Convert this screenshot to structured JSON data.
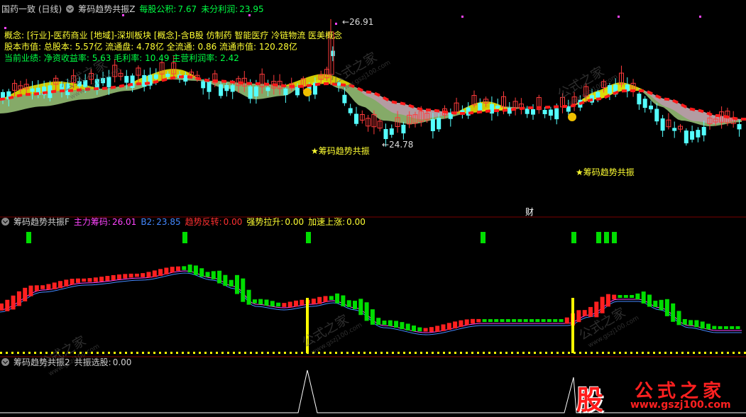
{
  "header": {
    "title": "国药一致 (日线)",
    "indicator": "筹码趋势共振Z",
    "eps_label": "每股公积:",
    "eps_value": "7.67",
    "profit_label": "未分利润:",
    "profit_value": "23.95"
  },
  "info": {
    "line1": "概念: [行业]-医药商业 [地域]-深圳板块 [概念]-含B股 仿制药 智能医疗 冷链物流 医美概念",
    "line2": "股本市值: 总股本: 5.57亿 流通盘: 4.78亿 全流通: 0.86 流通市值: 120.28亿",
    "line3": "当前业绩: 净资收益率: 5.63 毛利率: 10.49 主营利润率: 2.42"
  },
  "annotations": {
    "high": "26.91",
    "low": "24.78",
    "signal1": "★筹码趋势共振",
    "signal2": "★筹码趋势共振",
    "cai": "财"
  },
  "panel2": {
    "name": "筹码趋势共振F",
    "l1": "主力筹码:",
    "v1": "26.01",
    "l2": "B2:",
    "v2": "23.85",
    "l3": "趋势反转:",
    "v3": "0.00",
    "l4": "强势拉升:",
    "v4": "0.00",
    "l5": "加速上涨:",
    "v5": "0.00"
  },
  "panel3": {
    "name": "筹码趋势共振2",
    "l1": "共振选股:",
    "v1": "0.00"
  },
  "watermark": {
    "text": "公式之家",
    "url": "www.gszj100.com",
    "logo_char": "股"
  },
  "colors": {
    "up": "#ff3b3b",
    "down": "#54ffff",
    "green_bar": "#00dd00",
    "red_bar": "#ff2020",
    "yellow": "#ffff00",
    "magenta": "#ff44ff"
  },
  "chart_data": [
    {
      "type": "candlestick",
      "title": "国药一致 (日线)",
      "annotated_high": 26.91,
      "annotated_low": 24.78
    },
    {
      "type": "bar",
      "series": [
        {
          "name": "主力筹码",
          "last": 26.01
        },
        {
          "name": "B2",
          "last": 23.85
        },
        {
          "name": "趋势反转",
          "last": 0.0
        },
        {
          "name": "强势拉升",
          "last": 0.0
        },
        {
          "name": "加速上涨",
          "last": 0.0
        }
      ]
    },
    {
      "type": "line",
      "series": [
        {
          "name": "共振选股",
          "last": 0.0
        }
      ]
    }
  ]
}
